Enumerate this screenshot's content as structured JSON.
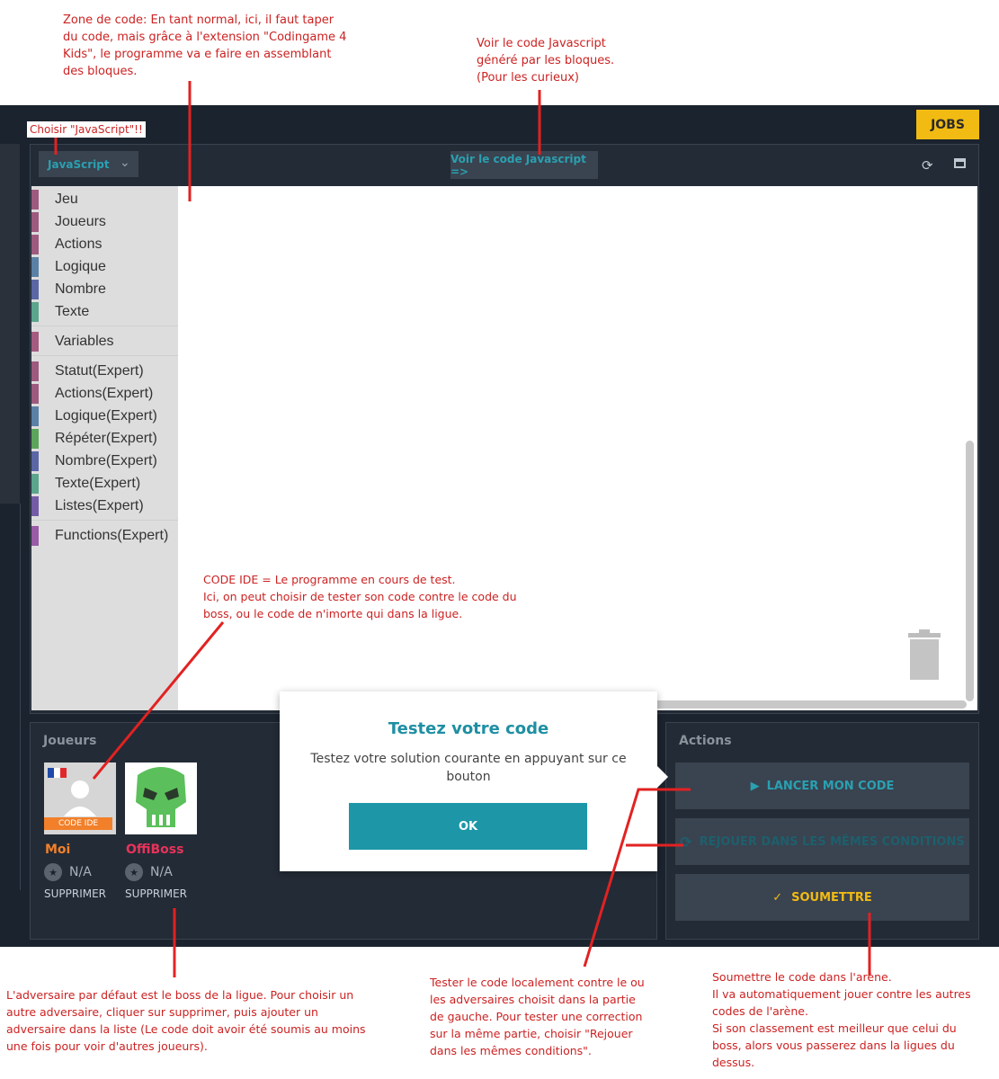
{
  "annotations": {
    "code_zone": "Zone de code: En tant normal, ici, il faut taper\ndu code, mais grâce à l'extension \"Codingame 4\nKids\", le programme va e faire en assemblant\ndes bloques.",
    "view_js": "Voir le code Javascript\ngénéré par les bloques.\n(Pour les curieux)",
    "choose_js": "Choisir \"JavaScript\"!!",
    "code_ide": "CODE IDE = Le programme en cours de test.\nIci, on peut choisir de tester son code contre le code du\nboss, ou le code de n'imorte qui dans la ligue.",
    "default_opponent": "L'adversaire par défaut est le boss de la ligue. Pour choisir un\nautre adversaire, cliquer sur supprimer, puis ajouter un\nadversaire dans la liste (Le code doit avoir été soumis au moins\nune fois pour voir d'autres joueurs).",
    "test_locally": "Tester le code localement contre le ou\nles adversaires choisit dans la partie\nde gauche. Pour tester une correction\nsur la même partie, choisir \"Rejouer\ndans les mêmes conditions\".",
    "submit": "Soumettre le code dans l'arène.\nIl va automatiquement jouer contre les autres\ncodes de l'arène.\nSi son classement est meilleur que celui du\nboss, alors vous passerez dans la ligues du\ndessus."
  },
  "header": {
    "jobs_label": "JOBS"
  },
  "editor": {
    "language": "JavaScript",
    "view_js_label": "Voir le code Javascript =>",
    "toolbox": [
      {
        "label": "Jeu",
        "color": "#9e5a7e"
      },
      {
        "label": "Joueurs",
        "color": "#9e5a7e"
      },
      {
        "label": "Actions",
        "color": "#9e5a7e"
      },
      {
        "label": "Logique",
        "color": "#5b80a5"
      },
      {
        "label": "Nombre",
        "color": "#5b67a5"
      },
      {
        "label": "Texte",
        "color": "#5ba58c"
      },
      {
        "label": "Variables",
        "color": "#a55b80"
      },
      {
        "label": "Statut(Expert)",
        "color": "#9e5a7e"
      },
      {
        "label": "Actions(Expert)",
        "color": "#9e5a7e"
      },
      {
        "label": "Logique(Expert)",
        "color": "#5b80a5"
      },
      {
        "label": "Répéter(Expert)",
        "color": "#5ba55b"
      },
      {
        "label": "Nombre(Expert)",
        "color": "#5b67a5"
      },
      {
        "label": "Texte(Expert)",
        "color": "#5ba58c"
      },
      {
        "label": "Listes(Expert)",
        "color": "#745ba5"
      },
      {
        "label": "Functions(Expert)",
        "color": "#995ba5"
      }
    ]
  },
  "players": {
    "title": "Joueurs",
    "list": [
      {
        "name": "Moi",
        "name_color": "#f2802a",
        "badge": "CODE IDE",
        "rank": "N/A",
        "delete_label": "SUPPRIMER"
      },
      {
        "name": "OffiBoss",
        "name_color": "#e8325a",
        "rank": "N/A",
        "delete_label": "SUPPRIMER"
      }
    ]
  },
  "actions": {
    "title": "Actions",
    "run_label": "LANCER MON CODE",
    "replay_label": "REJOUER DANS LES MÊMES CONDITIONS",
    "submit_label": "SOUMETTRE"
  },
  "modal": {
    "title": "Testez votre code",
    "text": "Testez votre solution courante en appuyant sur ce bouton",
    "ok_label": "OK"
  }
}
